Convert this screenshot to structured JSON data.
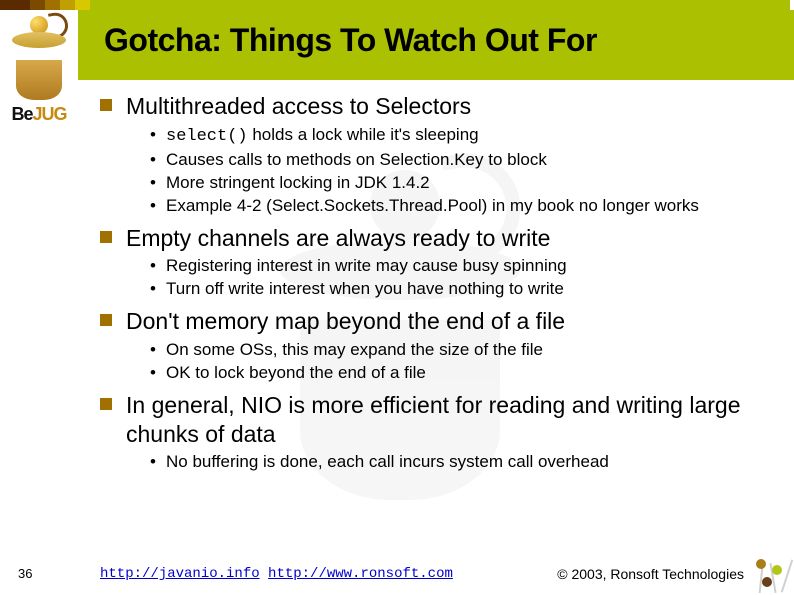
{
  "logo_text_prefix": "Be",
  "logo_text_suffix": "JUG",
  "title": "Gotcha: Things To Watch Out For",
  "bullets": [
    {
      "text": "Multithreaded access to Selectors",
      "sub": [
        {
          "code": "select()",
          "after": " holds a lock while it's sleeping"
        },
        {
          "text": "Causes calls to methods on Selection.Key to block"
        },
        {
          "text": "More stringent locking in JDK 1.4.2"
        },
        {
          "text": "Example 4-2 (Select.Sockets.Thread.Pool) in my book no longer works"
        }
      ]
    },
    {
      "text": "Empty channels are always ready to write",
      "sub": [
        {
          "text": "Registering interest in write may cause busy spinning"
        },
        {
          "text": "Turn off write interest when you have nothing to write"
        }
      ]
    },
    {
      "text": "Don't memory map beyond the end of a file",
      "sub": [
        {
          "text": "On some OSs, this may expand the size of the file"
        },
        {
          "text": "OK to lock beyond the end of a file"
        }
      ]
    },
    {
      "text": "In general, NIO is more efficient for reading and writing large chunks of data",
      "sub": [
        {
          "text": "No buffering is done, each call incurs system call overhead"
        }
      ]
    }
  ],
  "page_number": "36",
  "footer": {
    "link1_text": "http://javanio.info",
    "link2_text": "http://www.ronsoft.com",
    "copyright": "© 2003, Ronsoft Technologies"
  }
}
